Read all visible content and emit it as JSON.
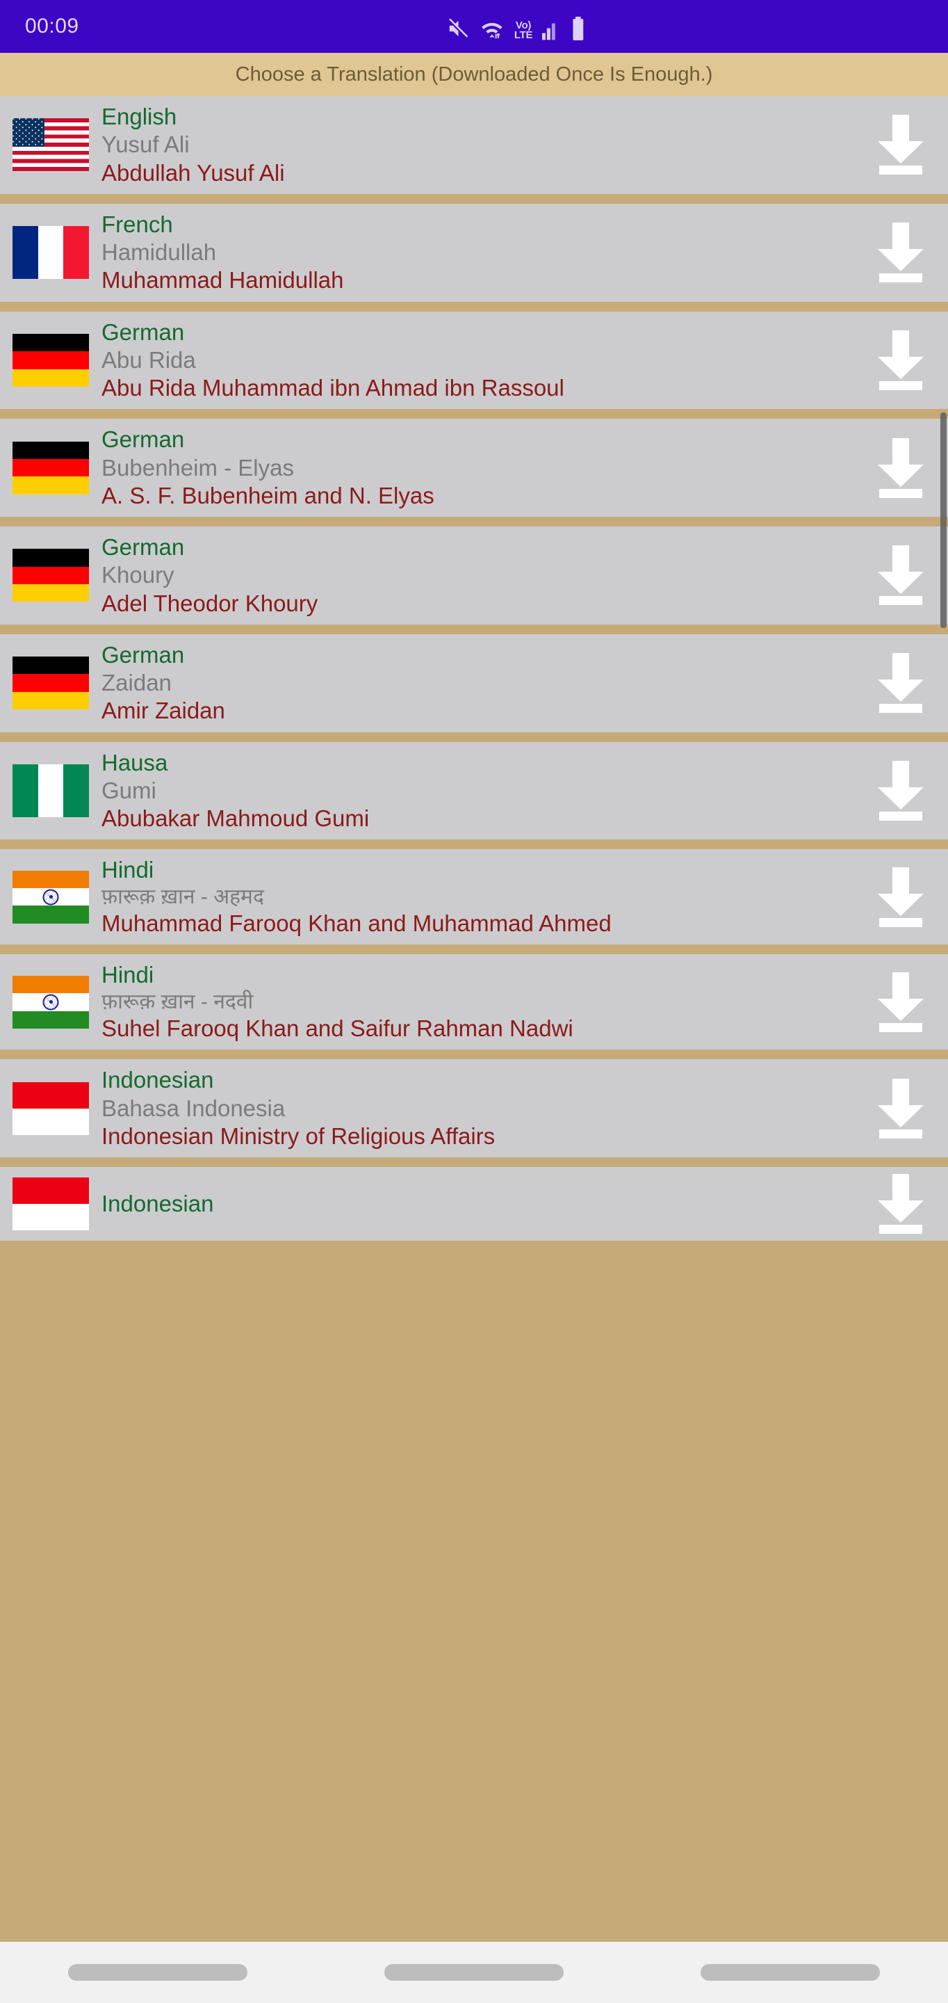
{
  "status_bar": {
    "time": "00:09",
    "icons": [
      "mute-icon",
      "wifi-icon",
      "volte-icon",
      "signal-icon",
      "battery-icon"
    ],
    "volte_top": "Vo)",
    "volte_bottom": "LTE",
    "background_color": "#3d05c4"
  },
  "header": {
    "title": "Choose a Translation (Downloaded Once Is Enough.)",
    "background_color": "#e0c693",
    "text_color": "#6b5c36"
  },
  "colors": {
    "language": "#15692f",
    "subtitle": "#7b7b7b",
    "author": "#8b1a1a",
    "row_background": "#ccccce",
    "divider": "#c6ab78"
  },
  "list": {
    "download_label": "download-icon",
    "items": [
      {
        "language": "English",
        "subtitle": "Yusuf Ali",
        "author": "Abdullah Yusuf Ali",
        "flag": "us",
        "flag_name": "flag-united-states"
      },
      {
        "language": "French",
        "subtitle": "Hamidullah",
        "author": "Muhammad Hamidullah",
        "flag": "fr",
        "flag_name": "flag-france"
      },
      {
        "language": "German",
        "subtitle": "Abu Rida",
        "author": "Abu Rida Muhammad ibn Ahmad ibn Rassoul",
        "flag": "de",
        "flag_name": "flag-germany"
      },
      {
        "language": "German",
        "subtitle": "Bubenheim - Elyas",
        "author": "A. S. F. Bubenheim and N. Elyas",
        "flag": "de",
        "flag_name": "flag-germany"
      },
      {
        "language": "German",
        "subtitle": "Khoury",
        "author": "Adel Theodor Khoury",
        "flag": "de",
        "flag_name": "flag-germany"
      },
      {
        "language": "German",
        "subtitle": "Zaidan",
        "author": "Amir Zaidan",
        "flag": "de",
        "flag_name": "flag-germany"
      },
      {
        "language": "Hausa",
        "subtitle": "Gumi",
        "author": "Abubakar Mahmoud Gumi",
        "flag": "ng",
        "flag_name": "flag-nigeria"
      },
      {
        "language": "Hindi",
        "subtitle": "फ़ारूक़ ख़ान - अहमद",
        "author": "Muhammad Farooq Khan and Muhammad Ahmed",
        "flag": "in",
        "flag_name": "flag-india"
      },
      {
        "language": "Hindi",
        "subtitle": "फ़ारूक़ ख़ान - नदवी",
        "author": "Suhel Farooq Khan and Saifur Rahman Nadwi",
        "flag": "in",
        "flag_name": "flag-india"
      },
      {
        "language": "Indonesian",
        "subtitle": "Bahasa Indonesia",
        "author": "Indonesian Ministry of Religious Affairs",
        "flag": "id",
        "flag_name": "flag-indonesia"
      },
      {
        "language": "Indonesian",
        "subtitle": "",
        "author": "",
        "flag": "id",
        "flag_name": "flag-indonesia"
      }
    ]
  },
  "navigation_bar": {
    "buttons": [
      "recents-button",
      "home-button",
      "back-button"
    ]
  }
}
